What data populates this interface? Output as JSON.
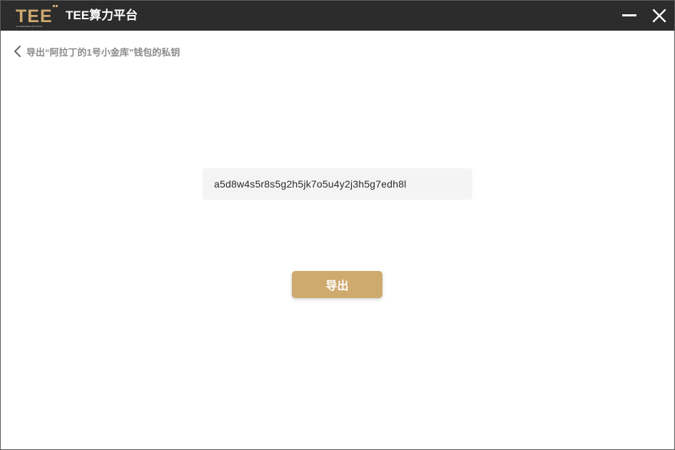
{
  "window": {
    "app_title": "TEE算力平台",
    "logo_text": "TEE",
    "logo_tagline": "IN HARDWARE WE TRUST"
  },
  "page": {
    "back_title": "导出“阿拉丁的1号小金库”钱包的私钥"
  },
  "private_key": {
    "value": "a5d8w4s5r8s5g2h5jk7o5u4y2j3h5g7edh8l"
  },
  "actions": {
    "export_label": "导出"
  },
  "colors": {
    "titlebar": "#2c2c2c",
    "accent": "#cfaa6e",
    "key_box_bg": "#f4f4f4"
  },
  "icons": {
    "minimize": "minimize-icon",
    "close": "close-icon",
    "back": "chevron-left-icon"
  }
}
